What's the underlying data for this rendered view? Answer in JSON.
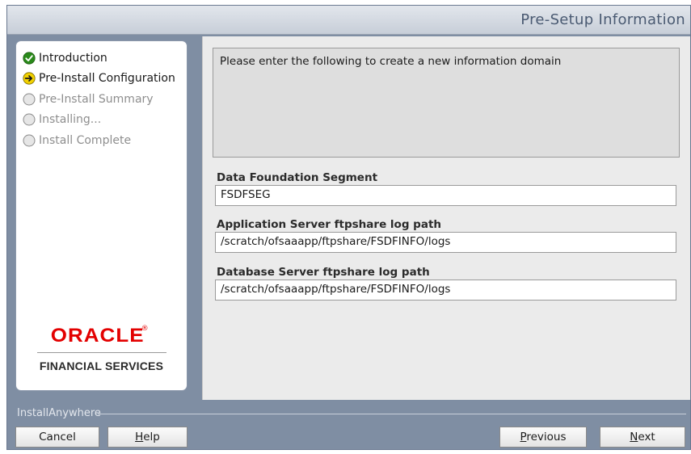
{
  "window": {
    "title": "Pre-Setup Information"
  },
  "steps": [
    {
      "label": "Introduction",
      "state": "done",
      "icon": "check-circle-icon"
    },
    {
      "label": "Pre-Install Configuration",
      "state": "current",
      "icon": "arrow-circle-icon"
    },
    {
      "label": "Pre-Install Summary",
      "state": "pending",
      "icon": "empty-circle-icon"
    },
    {
      "label": "Installing...",
      "state": "pending",
      "icon": "empty-circle-icon"
    },
    {
      "label": "Install Complete",
      "state": "pending",
      "icon": "empty-circle-icon"
    }
  ],
  "logo": {
    "brand": "ORACLE",
    "reg": "®",
    "subtitle": "FINANCIAL SERVICES"
  },
  "content": {
    "info_text": "Please enter the following to create a new information domain",
    "fields": [
      {
        "label": "Data Foundation Segment",
        "value": "FSDFSEG"
      },
      {
        "label": "Application Server ftpshare log path",
        "value": "/scratch/ofsaaapp/ftpshare/FSDFINFO/logs"
      },
      {
        "label": "Database Server ftpshare log path",
        "value": "/scratch/ofsaaapp/ftpshare/FSDFINFO/logs"
      }
    ]
  },
  "footer": {
    "label": "InstallAnywhere",
    "buttons": {
      "cancel": "Cancel",
      "help_mnemonic": "H",
      "help_rest": "elp",
      "previous_mnemonic": "P",
      "previous_rest": "revious",
      "next_mnemonic": "N",
      "next_rest": "ext"
    }
  },
  "colors": {
    "frame": "#7f8ea3",
    "oracle_red": "#e30000",
    "check_green": "#2a8a1a",
    "arrow_yellow": "#f2d100"
  }
}
